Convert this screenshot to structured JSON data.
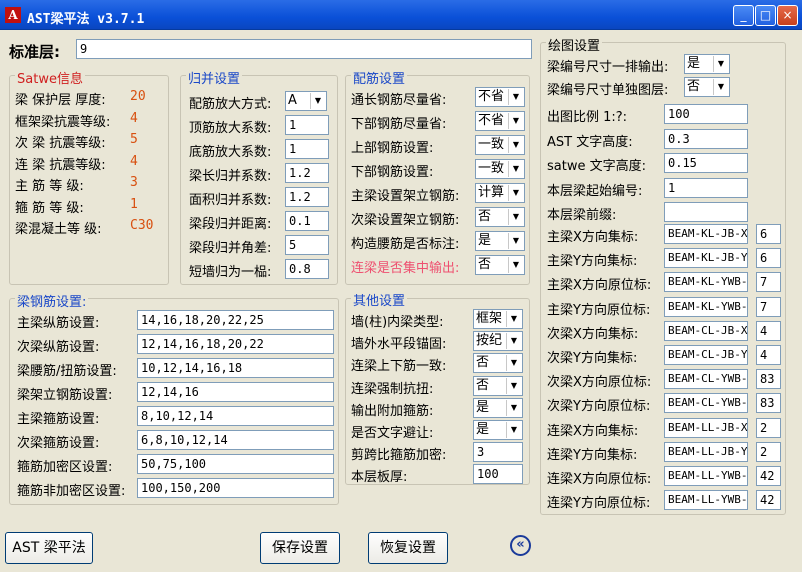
{
  "window": {
    "title": "AST梁平法 v3.7.1",
    "minimize": "_",
    "maximize": "□",
    "close": "×"
  },
  "std_floor": {
    "label": "标准层:",
    "value": "9"
  },
  "satwe": {
    "title": "Satwe信息",
    "rows": [
      {
        "label": "梁 保护层 厚度:",
        "value": "20"
      },
      {
        "label": "框架梁抗震等级:",
        "value": "4"
      },
      {
        "label": "次 梁 抗震等级:",
        "value": "5"
      },
      {
        "label": "连 梁 抗震等级:",
        "value": "4"
      },
      {
        "label": "主  筋  等  级:",
        "value": "3"
      },
      {
        "label": "箍  筋  等  级:",
        "value": "1"
      },
      {
        "label": "梁混凝土等  级:",
        "value": "C30"
      }
    ]
  },
  "merge": {
    "title": "归并设置",
    "rows": [
      {
        "label": "配筋放大方式:",
        "value": "A"
      },
      {
        "label": "顶筋放大系数:",
        "value": "1"
      },
      {
        "label": "底筋放大系数:",
        "value": "1"
      },
      {
        "label": "梁长归并系数:",
        "value": "1.2"
      },
      {
        "label": "面积归并系数:",
        "value": "1.2"
      },
      {
        "label": "梁段归并距离:",
        "value": "0.1"
      },
      {
        "label": "梁段归并角差:",
        "value": "5"
      },
      {
        "label": "短墙归为一榀:",
        "value": "0.8"
      }
    ]
  },
  "rebar": {
    "title": "配筋设置",
    "rows": [
      {
        "label": "通长钢筋尽量省:",
        "value": "不省"
      },
      {
        "label": "下部钢筋尽量省:",
        "value": "不省"
      },
      {
        "label": "上部钢筋设置:",
        "value": "一致"
      },
      {
        "label": "下部钢筋设置:",
        "value": "一致"
      },
      {
        "label": "主梁设置架立钢筋:",
        "value": "计算"
      },
      {
        "label": "次梁设置架立钢筋:",
        "value": "否"
      },
      {
        "label": "构造腰筋是否标注:",
        "value": "是"
      },
      {
        "label": "连梁是否集中输出:",
        "value": "否"
      }
    ]
  },
  "beam_rebar": {
    "title": "梁钢筋设置:",
    "rows": [
      {
        "label": "主梁纵筋设置:",
        "value": "14,16,18,20,22,25"
      },
      {
        "label": "次梁纵筋设置:",
        "value": "12,14,16,18,20,22"
      },
      {
        "label": "梁腰筋/扭筋设置:",
        "value": "10,12,14,16,18"
      },
      {
        "label": "梁架立钢筋设置:",
        "value": "12,14,16"
      },
      {
        "label": "主梁箍筋设置:",
        "value": "8,10,12,14"
      },
      {
        "label": "次梁箍筋设置:",
        "value": "6,8,10,12,14"
      },
      {
        "label": "箍筋加密区设置:",
        "value": "50,75,100"
      },
      {
        "label": "箍筋非加密区设置:",
        "value": "100,150,200"
      }
    ]
  },
  "other": {
    "title": "其他设置",
    "rows": [
      {
        "label": "墙(柱)内梁类型:",
        "value": "框架"
      },
      {
        "label": "墙外水平段锚固:",
        "value": "按纪"
      },
      {
        "label": "连梁上下筋一致:",
        "value": "否"
      },
      {
        "label": "连梁强制抗扭:",
        "value": "否"
      },
      {
        "label": "输出附加箍筋:",
        "value": "是"
      },
      {
        "label": "是否文字避让:",
        "value": "是"
      },
      {
        "label": "剪跨比箍筋加密:",
        "value": "3"
      },
      {
        "label": "本层板厚:",
        "value": "100"
      }
    ]
  },
  "draw": {
    "title": "绘图设置",
    "one_row": {
      "label": "梁编号尺寸一排输出:",
      "value": "是"
    },
    "sep_layer": {
      "label": "梁编号尺寸单独图层:",
      "value": "否"
    },
    "rows": [
      {
        "label": "出图比例 1:?:",
        "value": "100"
      },
      {
        "label": "AST 文字高度:",
        "value": "0.3"
      },
      {
        "label": "satwe 文字高度:",
        "value": "0.15"
      },
      {
        "label": "本层梁起始编号:",
        "value": "1"
      },
      {
        "label": "本层梁前缀:",
        "value": ""
      }
    ],
    "layers": [
      {
        "label": "主梁X方向集标:",
        "name": "BEAM-KL-JB-X",
        "color": "6"
      },
      {
        "label": "主梁Y方向集标:",
        "name": "BEAM-KL-JB-Y",
        "color": "6"
      },
      {
        "label": "主梁X方向原位标:",
        "name": "BEAM-KL-YWB-",
        "color": "7"
      },
      {
        "label": "主梁Y方向原位标:",
        "name": "BEAM-KL-YWB-",
        "color": "7"
      },
      {
        "label": "次梁X方向集标:",
        "name": "BEAM-CL-JB-X",
        "color": "4"
      },
      {
        "label": "次梁Y方向集标:",
        "name": "BEAM-CL-JB-Y",
        "color": "4"
      },
      {
        "label": "次梁X方向原位标:",
        "name": "BEAM-CL-YWB-",
        "color": "83"
      },
      {
        "label": "次梁Y方向原位标:",
        "name": "BEAM-CL-YWB-",
        "color": "83"
      },
      {
        "label": "连梁X方向集标:",
        "name": "BEAM-LL-JB-X",
        "color": "2"
      },
      {
        "label": "连梁Y方向集标:",
        "name": "BEAM-LL-JB-Y",
        "color": "2"
      },
      {
        "label": "连梁X方向原位标:",
        "name": "BEAM-LL-YWB-",
        "color": "42"
      },
      {
        "label": "连梁Y方向原位标:",
        "name": "BEAM-LL-YWB-",
        "color": "42"
      }
    ]
  },
  "buttons": {
    "ast": "AST 梁平法",
    "save": "保存设置",
    "restore": "恢复设置",
    "back": "«"
  }
}
